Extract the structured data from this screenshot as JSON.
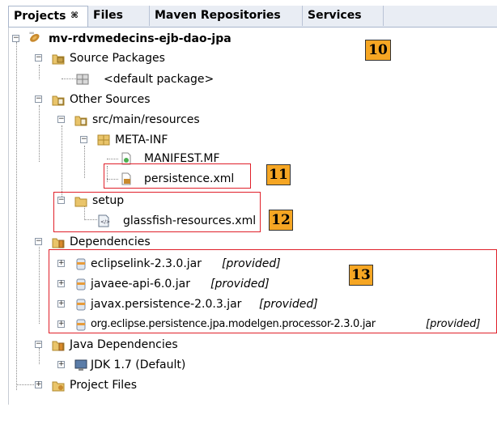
{
  "tabs": [
    {
      "label": "Projects",
      "close": "⌘"
    },
    {
      "label": "Files"
    },
    {
      "label": "Maven Repositories"
    },
    {
      "label": "Services"
    }
  ],
  "tree": {
    "project": "mv-rdvmedecins-ejb-dao-jpa",
    "source_packages": "Source Packages",
    "default_package": "<default package>",
    "other_sources": "Other Sources",
    "src_main_resources": "src/main/resources",
    "meta_inf": "META-INF",
    "manifest": "MANIFEST.MF",
    "persistence": "persistence.xml",
    "setup": "setup",
    "glassfish": "glassfish-resources.xml",
    "dependencies": "Dependencies",
    "deps": [
      {
        "name": "eclipselink-2.3.0.jar",
        "scope": "[provided]"
      },
      {
        "name": "javaee-api-6.0.jar",
        "scope": "[provided]"
      },
      {
        "name": "javax.persistence-2.0.3.jar",
        "scope": "[provided]"
      },
      {
        "name": "org.eclipse.persistence.jpa.modelgen.processor-2.3.0.jar",
        "scope": "[provided]"
      }
    ],
    "java_dependencies": "Java Dependencies",
    "jdk": "JDK 1.7 (Default)",
    "project_files": "Project Files"
  },
  "annotations": [
    "10",
    "11",
    "12",
    "13"
  ],
  "colors": {
    "annotation_bg": "#f6a623",
    "annotation_box": "#e0202a"
  }
}
